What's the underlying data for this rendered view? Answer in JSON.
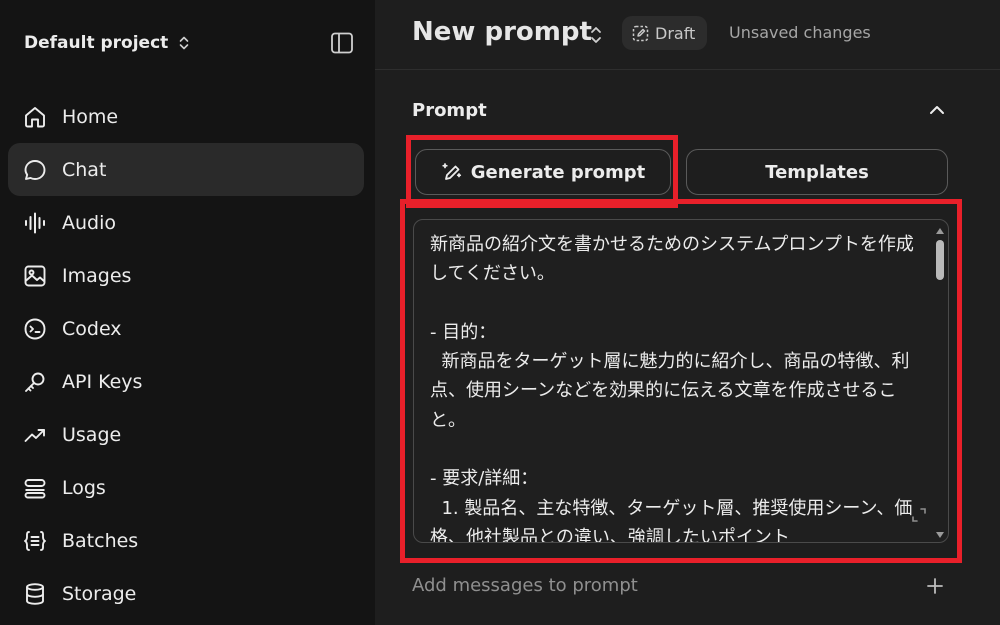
{
  "sidebar": {
    "project_name": "Default project",
    "items": [
      {
        "label": "Home",
        "icon": "home-icon",
        "active": false
      },
      {
        "label": "Chat",
        "icon": "chat-bubble-icon",
        "active": true
      },
      {
        "label": "Audio",
        "icon": "audio-wave-icon",
        "active": false
      },
      {
        "label": "Images",
        "icon": "image-icon",
        "active": false
      },
      {
        "label": "Codex",
        "icon": "codex-icon",
        "active": false
      },
      {
        "label": "API Keys",
        "icon": "key-icon",
        "active": false
      },
      {
        "label": "Usage",
        "icon": "trend-up-icon",
        "active": false
      },
      {
        "label": "Logs",
        "icon": "logs-stack-icon",
        "active": false
      },
      {
        "label": "Batches",
        "icon": "braces-list-icon",
        "active": false
      },
      {
        "label": "Storage",
        "icon": "database-icon",
        "active": false
      }
    ]
  },
  "header": {
    "title": "New prompt",
    "badge": "Draft",
    "status": "Unsaved changes"
  },
  "prompt_section": {
    "title": "Prompt",
    "generate_label": "Generate prompt",
    "templates_label": "Templates",
    "text": "新商品の紹介文を書かせるためのシステムプロンプトを作成してください。\n\n- 目的：\n  新商品をターゲット層に魅力的に紹介し、商品の特徴、利点、使用シーンなどを効果的に伝える文章を作成させること。\n\n- 要求/詳細：\n  1. 製品名、主な特徴、ターゲット層、推奨使用シーン、価格、他社製品との違い、強調したいポイント",
    "add_messages_label": "Add messages to prompt"
  },
  "colors": {
    "sidebar_bg": "#141414",
    "main_bg": "#1e1e1e",
    "active_item_bg": "#2a2a2a",
    "highlight": "#e8202a"
  }
}
